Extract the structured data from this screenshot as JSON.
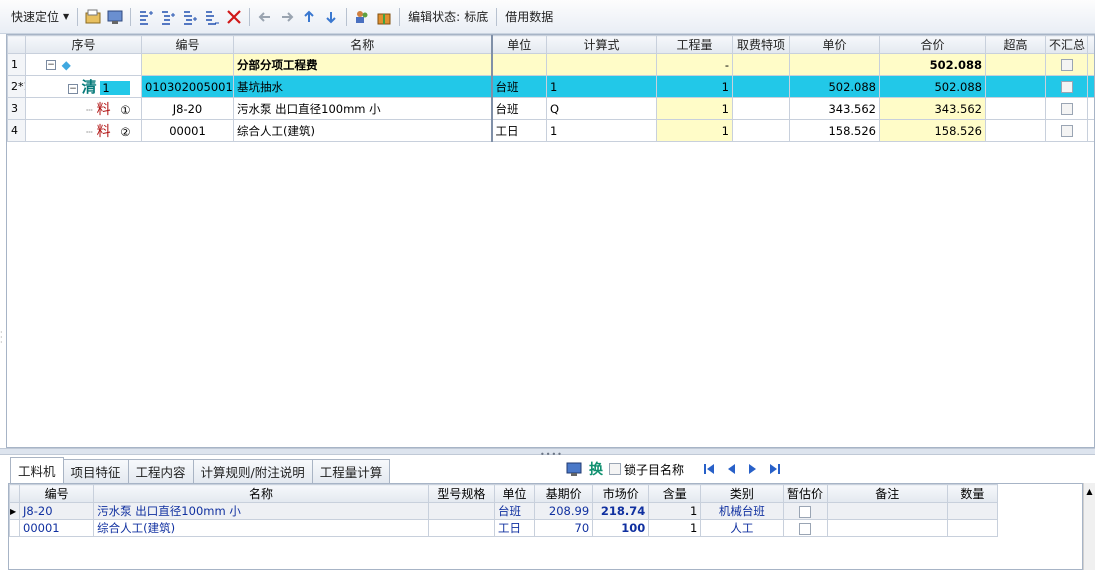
{
  "toolbar": {
    "quick_locate": "快速定位",
    "edit_status_label": "编辑状态:",
    "edit_status_value": "标底",
    "borrow_data": "借用数据"
  },
  "main_grid": {
    "headers": [
      "序号",
      "编号",
      "名称",
      "单位",
      "计算式",
      "工程量",
      "取费特项",
      "单价",
      "合价",
      "超高",
      "不汇总"
    ],
    "rows": [
      {
        "rn": "1",
        "tag": "",
        "seq": "",
        "code": "",
        "name": "分部分项工程费",
        "unit": "",
        "formula": "",
        "qty": "-",
        "fee": "",
        "price": "",
        "total": "502.088"
      },
      {
        "rn": "2*1",
        "tag": "清",
        "seq": "1",
        "code": "010302005001",
        "name": "基坑抽水",
        "unit": "台班",
        "formula": "1",
        "qty": "1",
        "fee": "",
        "price": "502.088",
        "total": "502.088"
      },
      {
        "rn": "3",
        "tag": "料",
        "seq": "①",
        "code": "J8-20",
        "name": "污水泵 出口直径100mm  小",
        "unit": "台班",
        "formula": "Q",
        "qty": "1",
        "fee": "",
        "price": "343.562",
        "total": "343.562"
      },
      {
        "rn": "4",
        "tag": "料",
        "seq": "②",
        "code": "00001",
        "name": "综合人工(建筑)",
        "unit": "工日",
        "formula": "1",
        "qty": "1",
        "fee": "",
        "price": "158.526",
        "total": "158.526"
      }
    ]
  },
  "tabs": [
    "工料机",
    "项目特征",
    "工程内容",
    "计算规则/附注说明",
    "工程量计算"
  ],
  "lower_tools": {
    "swap_label": "换",
    "lock_label": "锁子目名称"
  },
  "sub_grid": {
    "headers": [
      "编号",
      "名称",
      "型号规格",
      "单位",
      "基期价",
      "市场价",
      "含量",
      "类别",
      "暂估价",
      "备注",
      "数量"
    ],
    "rows": [
      {
        "code": "J8-20",
        "name": "污水泵 出口直径100mm  小",
        "spec": "",
        "unit": "台班",
        "base": "208.99",
        "market": "218.74",
        "content": "1",
        "category": "机械台班",
        "remark": "",
        "amount": ""
      },
      {
        "code": "00001",
        "name": "综合人工(建筑)",
        "spec": "",
        "unit": "工日",
        "base": "70",
        "market": "100",
        "content": "1",
        "category": "人工",
        "remark": "",
        "amount": ""
      }
    ]
  }
}
